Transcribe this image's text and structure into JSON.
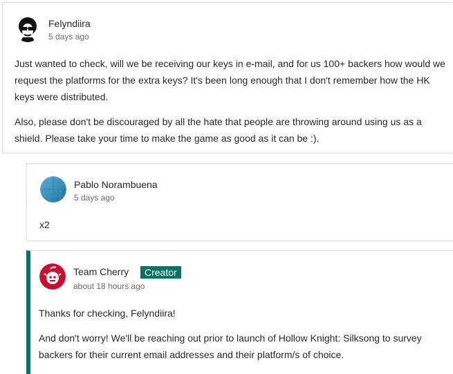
{
  "comments": [
    {
      "author": "Felyndiira",
      "time": "5 days ago",
      "paragraphs": [
        "Just wanted to check, will we be receiving our keys in e-mail, and for us 100+ backers how would we request the platforms for the extra keys? It's been long enough that I don't remember how the HK keys were distributed.",
        "Also, please don't be discouraged by all the hate that people are throwing around using us as a shield. Please take your time to make the game as good as it can be :)."
      ]
    },
    {
      "author": "Pablo Norambuena",
      "time": "5 days ago",
      "paragraphs": [
        "x2"
      ]
    },
    {
      "author": "Team Cherry",
      "badge": "Creator",
      "time": "about 18 hours ago",
      "paragraphs": [
        "Thanks for checking, Felyndiira!",
        "And don't worry! We'll be reaching out prior to launch of Hollow Knight: Silksong to survey backers for their current email addresses and their platform/s of choice."
      ]
    }
  ],
  "colors": {
    "creator_accent": "#037362",
    "border": "#dcdcdc",
    "muted_text": "#6a6a6a"
  }
}
